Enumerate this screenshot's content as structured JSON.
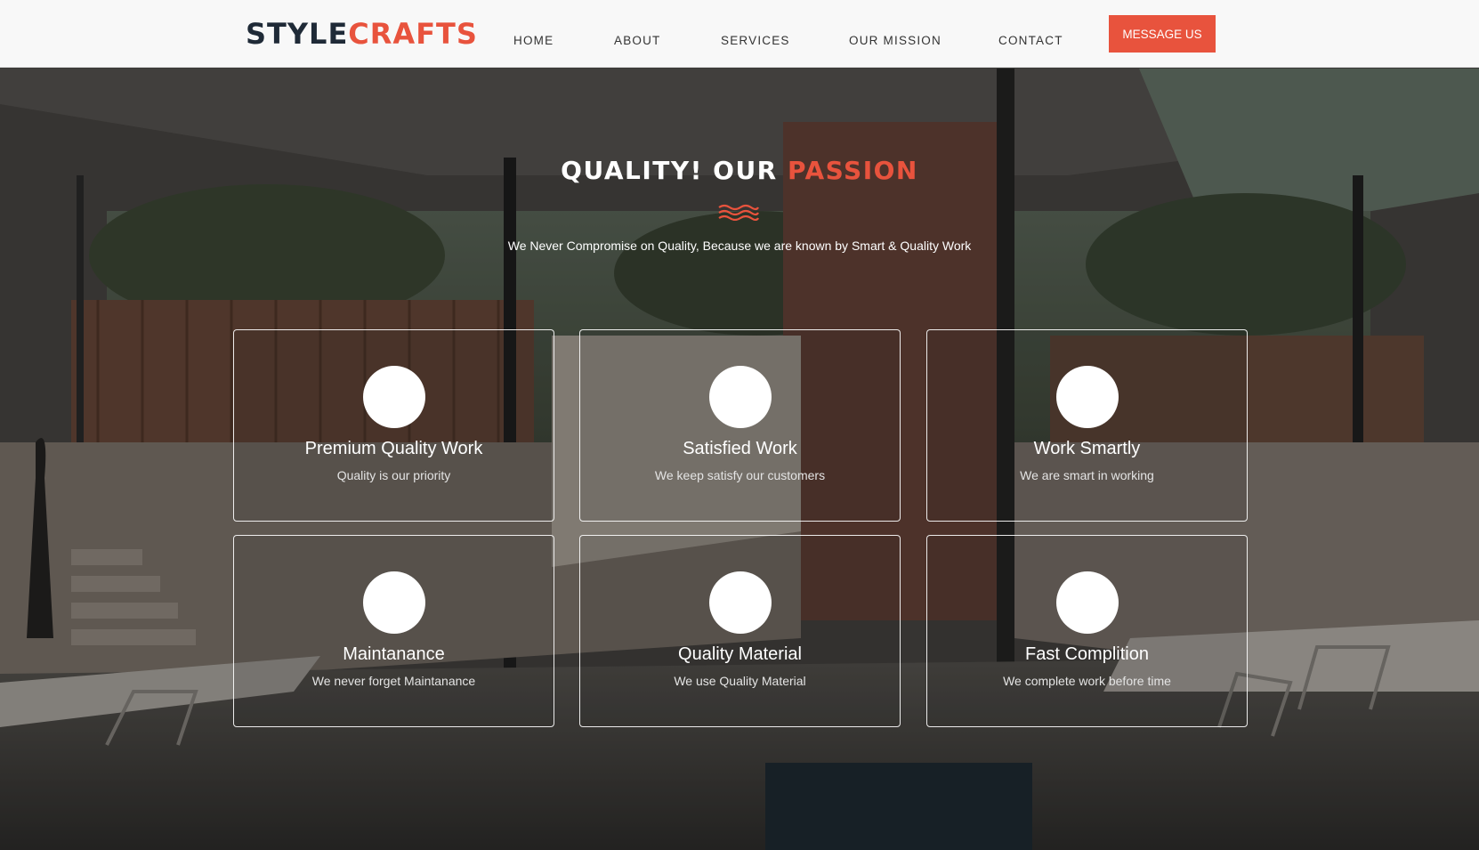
{
  "brand": {
    "part1": "STYLE",
    "part2": "CRAFTS"
  },
  "nav": [
    "HOME",
    "ABOUT",
    "SERVICES",
    "OUR MISSION",
    "CONTACT"
  ],
  "cta_label": "MESSAGE US",
  "colors": {
    "accent": "#e8533d",
    "dark": "#1f2a37",
    "header_bg": "#f8f8f8"
  },
  "hero": {
    "title_part1": "QUALITY! OUR ",
    "title_part2": "PASSION",
    "subtitle": "We Never Compromise on Quality, Because we are known by Smart & Quality Work",
    "divider_icon": "wave-icon"
  },
  "features": [
    {
      "title": "Premium Quality Work",
      "desc": "Quality is our priority"
    },
    {
      "title": "Satisfied Work",
      "desc": "We keep satisfy our customers"
    },
    {
      "title": "Work Smartly",
      "desc": "We are smart in working"
    },
    {
      "title": "Maintanance",
      "desc": "We never forget Maintanance"
    },
    {
      "title": "Quality Material",
      "desc": "We use Quality Material"
    },
    {
      "title": "Fast Complition",
      "desc": "We complete work before time"
    }
  ]
}
